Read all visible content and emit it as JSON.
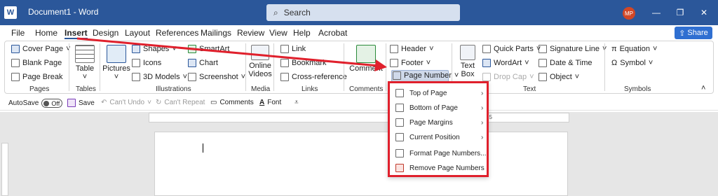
{
  "titlebar": {
    "doc_title": "Document1  -  Word",
    "search": "Search",
    "avatar": "MP",
    "min": "—",
    "restore": "❐",
    "close": "✕"
  },
  "tabs": [
    "File",
    "Home",
    "Insert",
    "Design",
    "Layout",
    "References",
    "Mailings",
    "Review",
    "View",
    "Help",
    "Acrobat"
  ],
  "share": "Share",
  "ribbon": {
    "pages": {
      "label": "Pages",
      "items": [
        "Cover Page",
        "Blank Page",
        "Page Break"
      ]
    },
    "tables": {
      "label": "Tables",
      "table": "Table"
    },
    "illustrations": {
      "label": "Illustrations",
      "pictures": "Pictures",
      "shapes": "Shapes",
      "icons": "Icons",
      "models": "3D Models",
      "smartart": "SmartArt",
      "chart": "Chart",
      "screenshot": "Screenshot"
    },
    "media": {
      "label": "Media",
      "online_videos_1": "Online",
      "online_videos_2": "Videos"
    },
    "links": {
      "label": "Links",
      "link": "Link",
      "bookmark": "Bookmark",
      "crossref": "Cross-reference"
    },
    "comments": {
      "label": "Comments",
      "comment": "Comment"
    },
    "hf": {
      "header": "Header",
      "footer": "Footer",
      "page_number": "Page Number"
    },
    "text": {
      "label": "Text",
      "textbox_1": "Text",
      "textbox_2": "Box",
      "quickparts": "Quick Parts",
      "wordart": "WordArt",
      "dropcap": "Drop Cap",
      "sigline": "Signature Line",
      "datetime": "Date & Time",
      "object": "Object"
    },
    "symbols": {
      "label": "Symbols",
      "equation": "Equation",
      "symbol": "Symbol"
    }
  },
  "qat": {
    "autosave": "AutoSave",
    "toggle": "Off",
    "save": "Save",
    "undo": "Can't Undo",
    "repeat": "Can't Repeat",
    "comments": "Comments",
    "font": "Font"
  },
  "ruler": {
    "mark": "15"
  },
  "menu": {
    "items": [
      "Top of Page",
      "Bottom of Page",
      "Page Margins",
      "Current Position",
      "Format Page Numbers...",
      "Remove Page Numbers"
    ]
  }
}
